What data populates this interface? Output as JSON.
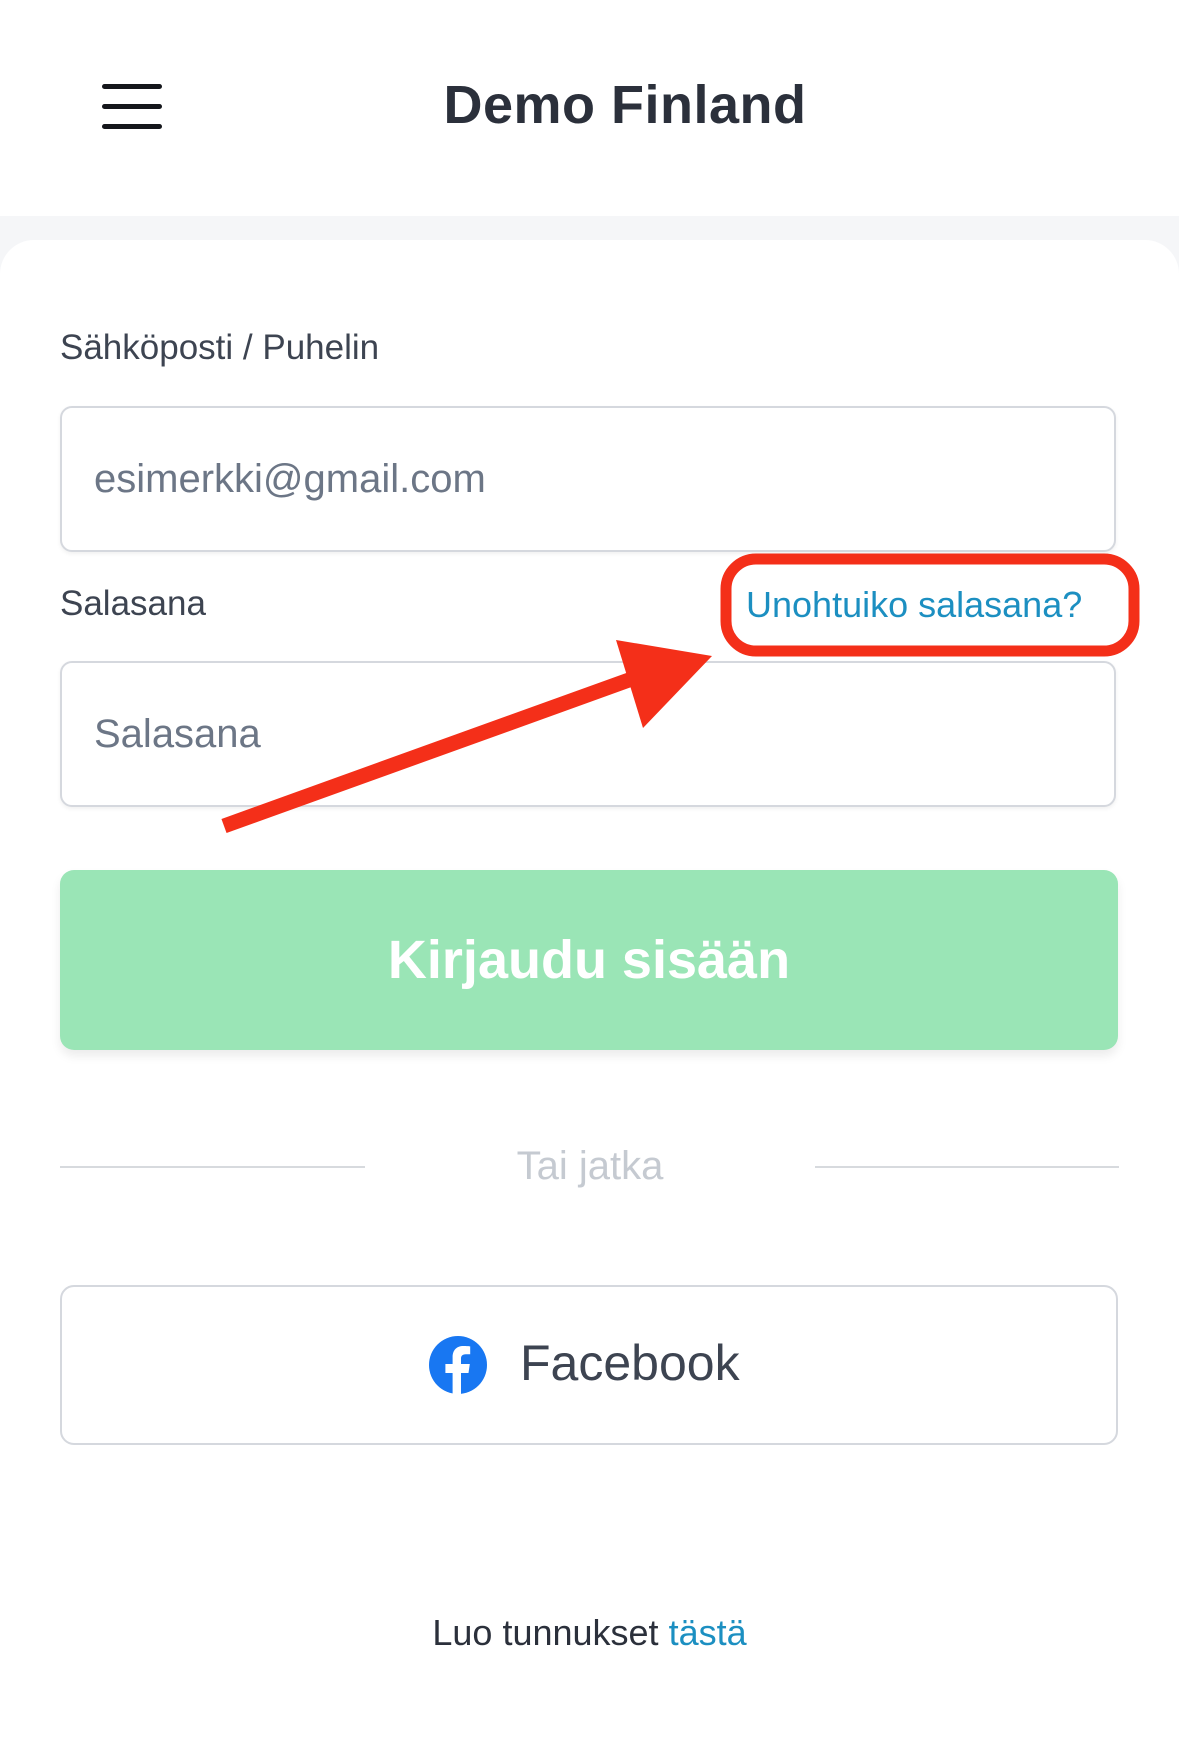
{
  "header": {
    "title": "Demo Finland",
    "menu_icon": "hamburger-menu-icon"
  },
  "login_form": {
    "email_label": "Sähköposti / Puhelin",
    "email_placeholder": "esimerkki@gmail.com",
    "email_value": "",
    "password_label": "Salasana",
    "forgot_password_link": "Unohtuiko salasana?",
    "password_placeholder": "Salasana",
    "password_value": "",
    "submit_label": "Kirjaudu sisään"
  },
  "divider": {
    "text": "Tai jatka"
  },
  "social": {
    "facebook_label": "Facebook",
    "facebook_icon": "facebook-icon"
  },
  "footer": {
    "register_prefix": "Luo tunnukset",
    "register_link": "tästä"
  },
  "colors": {
    "primary_button": "#9ae5b6",
    "link": "#1c8fc1",
    "annotation": "#f42f19",
    "facebook": "#1877f2"
  }
}
